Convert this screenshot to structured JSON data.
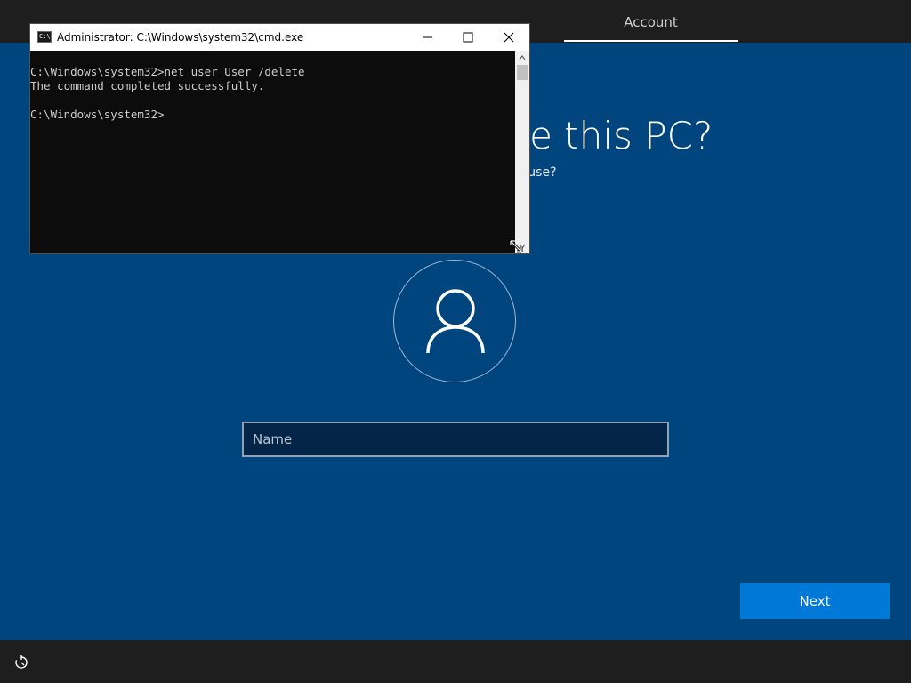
{
  "header": {
    "tab_label": "Account"
  },
  "main": {
    "heading": "Who's going to use this PC?",
    "subheading": "What name do you want to use?",
    "name_input": {
      "placeholder": "Name",
      "value": ""
    },
    "next_label": "Next"
  },
  "footer": {
    "icon": "ease-of-access-icon"
  },
  "cmd": {
    "title": "Administrator: C:\\Windows\\system32\\cmd.exe",
    "lines": [
      "C:\\Windows\\system32>net user User /delete",
      "The command completed successfully.",
      "",
      "C:\\Windows\\system32>"
    ]
  },
  "colors": {
    "oobe_background": "#01457f",
    "bars": "#1e1e1e",
    "accent": "#0078d7",
    "console_background": "#0c0c0c",
    "console_text": "#cccccc"
  }
}
